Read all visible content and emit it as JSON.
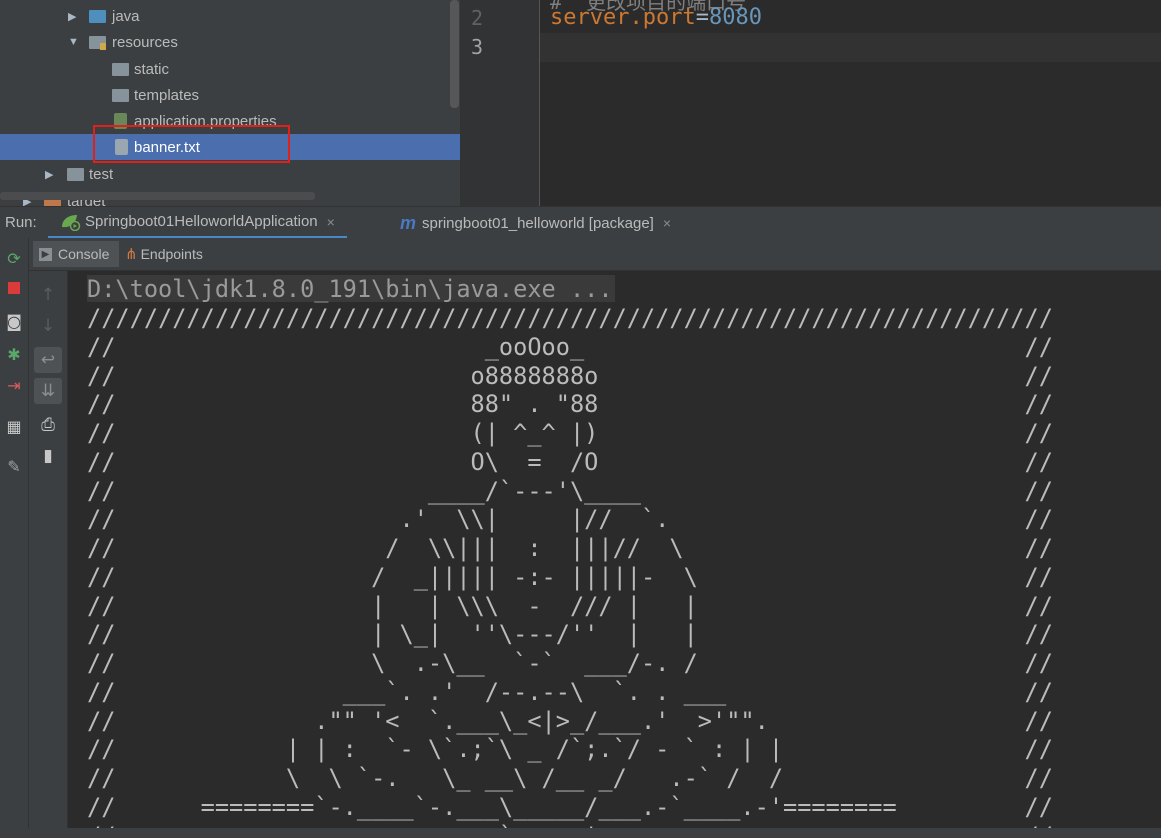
{
  "project_tree": {
    "items": [
      {
        "label": "java",
        "kind": "folder-source"
      },
      {
        "label": "resources",
        "kind": "folder-resources"
      },
      {
        "label": "static",
        "kind": "folder"
      },
      {
        "label": "templates",
        "kind": "folder"
      },
      {
        "label": "application.properties",
        "kind": "file-properties"
      },
      {
        "label": "banner.txt",
        "kind": "file-text",
        "selected": true
      },
      {
        "label": "test",
        "kind": "folder"
      },
      {
        "label": "target",
        "kind": "folder-excluded"
      }
    ],
    "highlight_color": "#e0211b",
    "selection_color": "#4b6eaf"
  },
  "editor": {
    "line_numbers": [
      "2",
      "3"
    ],
    "cut_text": "#  更改项目的端口号",
    "code": {
      "key": "server.port",
      "eq": "=",
      "value": "8080"
    }
  },
  "run_bar": {
    "label": "Run:",
    "tabs": [
      {
        "label": "Springboot01HelloworldApplication",
        "icon": "spring-boot-run-icon",
        "close": "×"
      },
      {
        "label": "springboot01_helloworld [package]",
        "icon": "maven-icon",
        "close": "×"
      }
    ]
  },
  "console_tabs": [
    {
      "label": "Console",
      "icon": "console-icon"
    },
    {
      "label": "Endpoints",
      "icon": "endpoints-icon"
    }
  ],
  "left_toolbar": [
    "rerun-icon",
    "stop-icon",
    "camera-icon",
    "debug-icon",
    "exit-icon",
    "layout-icon",
    "pin-icon"
  ],
  "console_toolbar": [
    "up-arrow-icon",
    "down-arrow-icon",
    "soft-wrap-icon",
    "scroll-to-end-icon",
    "print-icon",
    "trash-icon"
  ],
  "console": {
    "command": "D:\\tool\\jdk1.8.0_191\\bin\\java.exe ...",
    "banner_lines": [
      "////////////////////////////////////////////////////////////////////",
      "//                          _ooOoo_                               //",
      "//                         o8888888o                              //",
      "//                         88\" . \"88                              //",
      "//                         (| ^_^ |)                              //",
      "//                         O\\  =  /O                              //",
      "//                      ____/`---'\\____                           //",
      "//                    .'  \\\\|     |//  `.                         //",
      "//                   /  \\\\|||  :  |||//  \\                        //",
      "//                  /  _||||| -:- |||||-  \\                       //",
      "//                  |   | \\\\\\  -  /// |   |                       //",
      "//                  | \\_|  ''\\---/''  |   |                       //",
      "//                  \\  .-\\__  `-`  ___/-. /                       //",
      "//                ___`. .'  /--.--\\  `. . ___                     //",
      "//              .\"\" '<  `.___\\_<|>_/___.'  >'\"\".                  //",
      "//            | | :  `- \\`.;`\\ _ /`;.`/ - ` : | |                 //",
      "//            \\  \\ `-.   \\_ __\\ /__ _/   .-` /  /                 //",
      "//      ========`-.____`-.___\\_____/___.-`____.-'========         //",
      "//                           `=---='                              //"
    ]
  }
}
